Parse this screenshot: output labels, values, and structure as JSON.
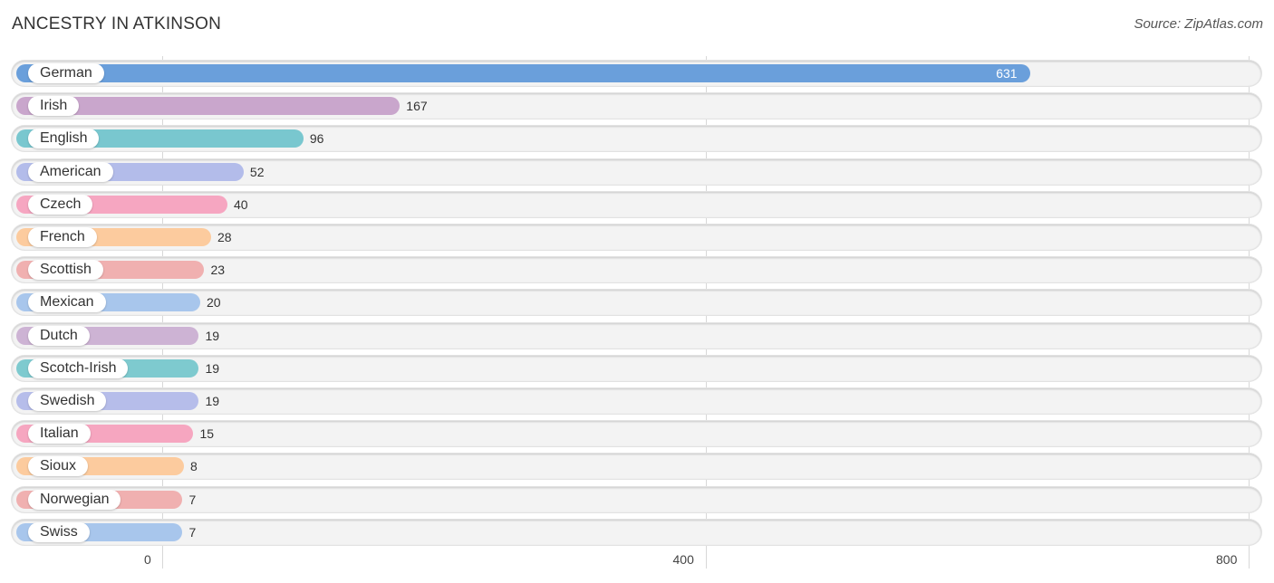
{
  "chart_data": {
    "type": "bar",
    "orientation": "horizontal",
    "title": "ANCESTRY IN ATKINSON",
    "source": "Source: ZipAtlas.com",
    "categories": [
      "German",
      "Irish",
      "English",
      "American",
      "Czech",
      "French",
      "Scottish",
      "Mexican",
      "Dutch",
      "Scotch-Irish",
      "Swedish",
      "Italian",
      "Sioux",
      "Norwegian",
      "Swiss"
    ],
    "values": [
      631,
      167,
      96,
      52,
      40,
      28,
      23,
      20,
      19,
      19,
      19,
      15,
      8,
      7,
      7
    ],
    "colors": [
      "#6a9fdb",
      "#c9a6cc",
      "#79c7cf",
      "#b3bcea",
      "#f6a6c1",
      "#fccb9e",
      "#f0b0b0",
      "#a8c6ec",
      "#cdb3d4",
      "#7ecacf",
      "#b6bdea",
      "#f6a6c0",
      "#fccb9e",
      "#f0b0b0",
      "#a8c6ec"
    ],
    "xticks": [
      0,
      400,
      800
    ],
    "xlim": [
      0,
      800
    ],
    "grid": true
  }
}
